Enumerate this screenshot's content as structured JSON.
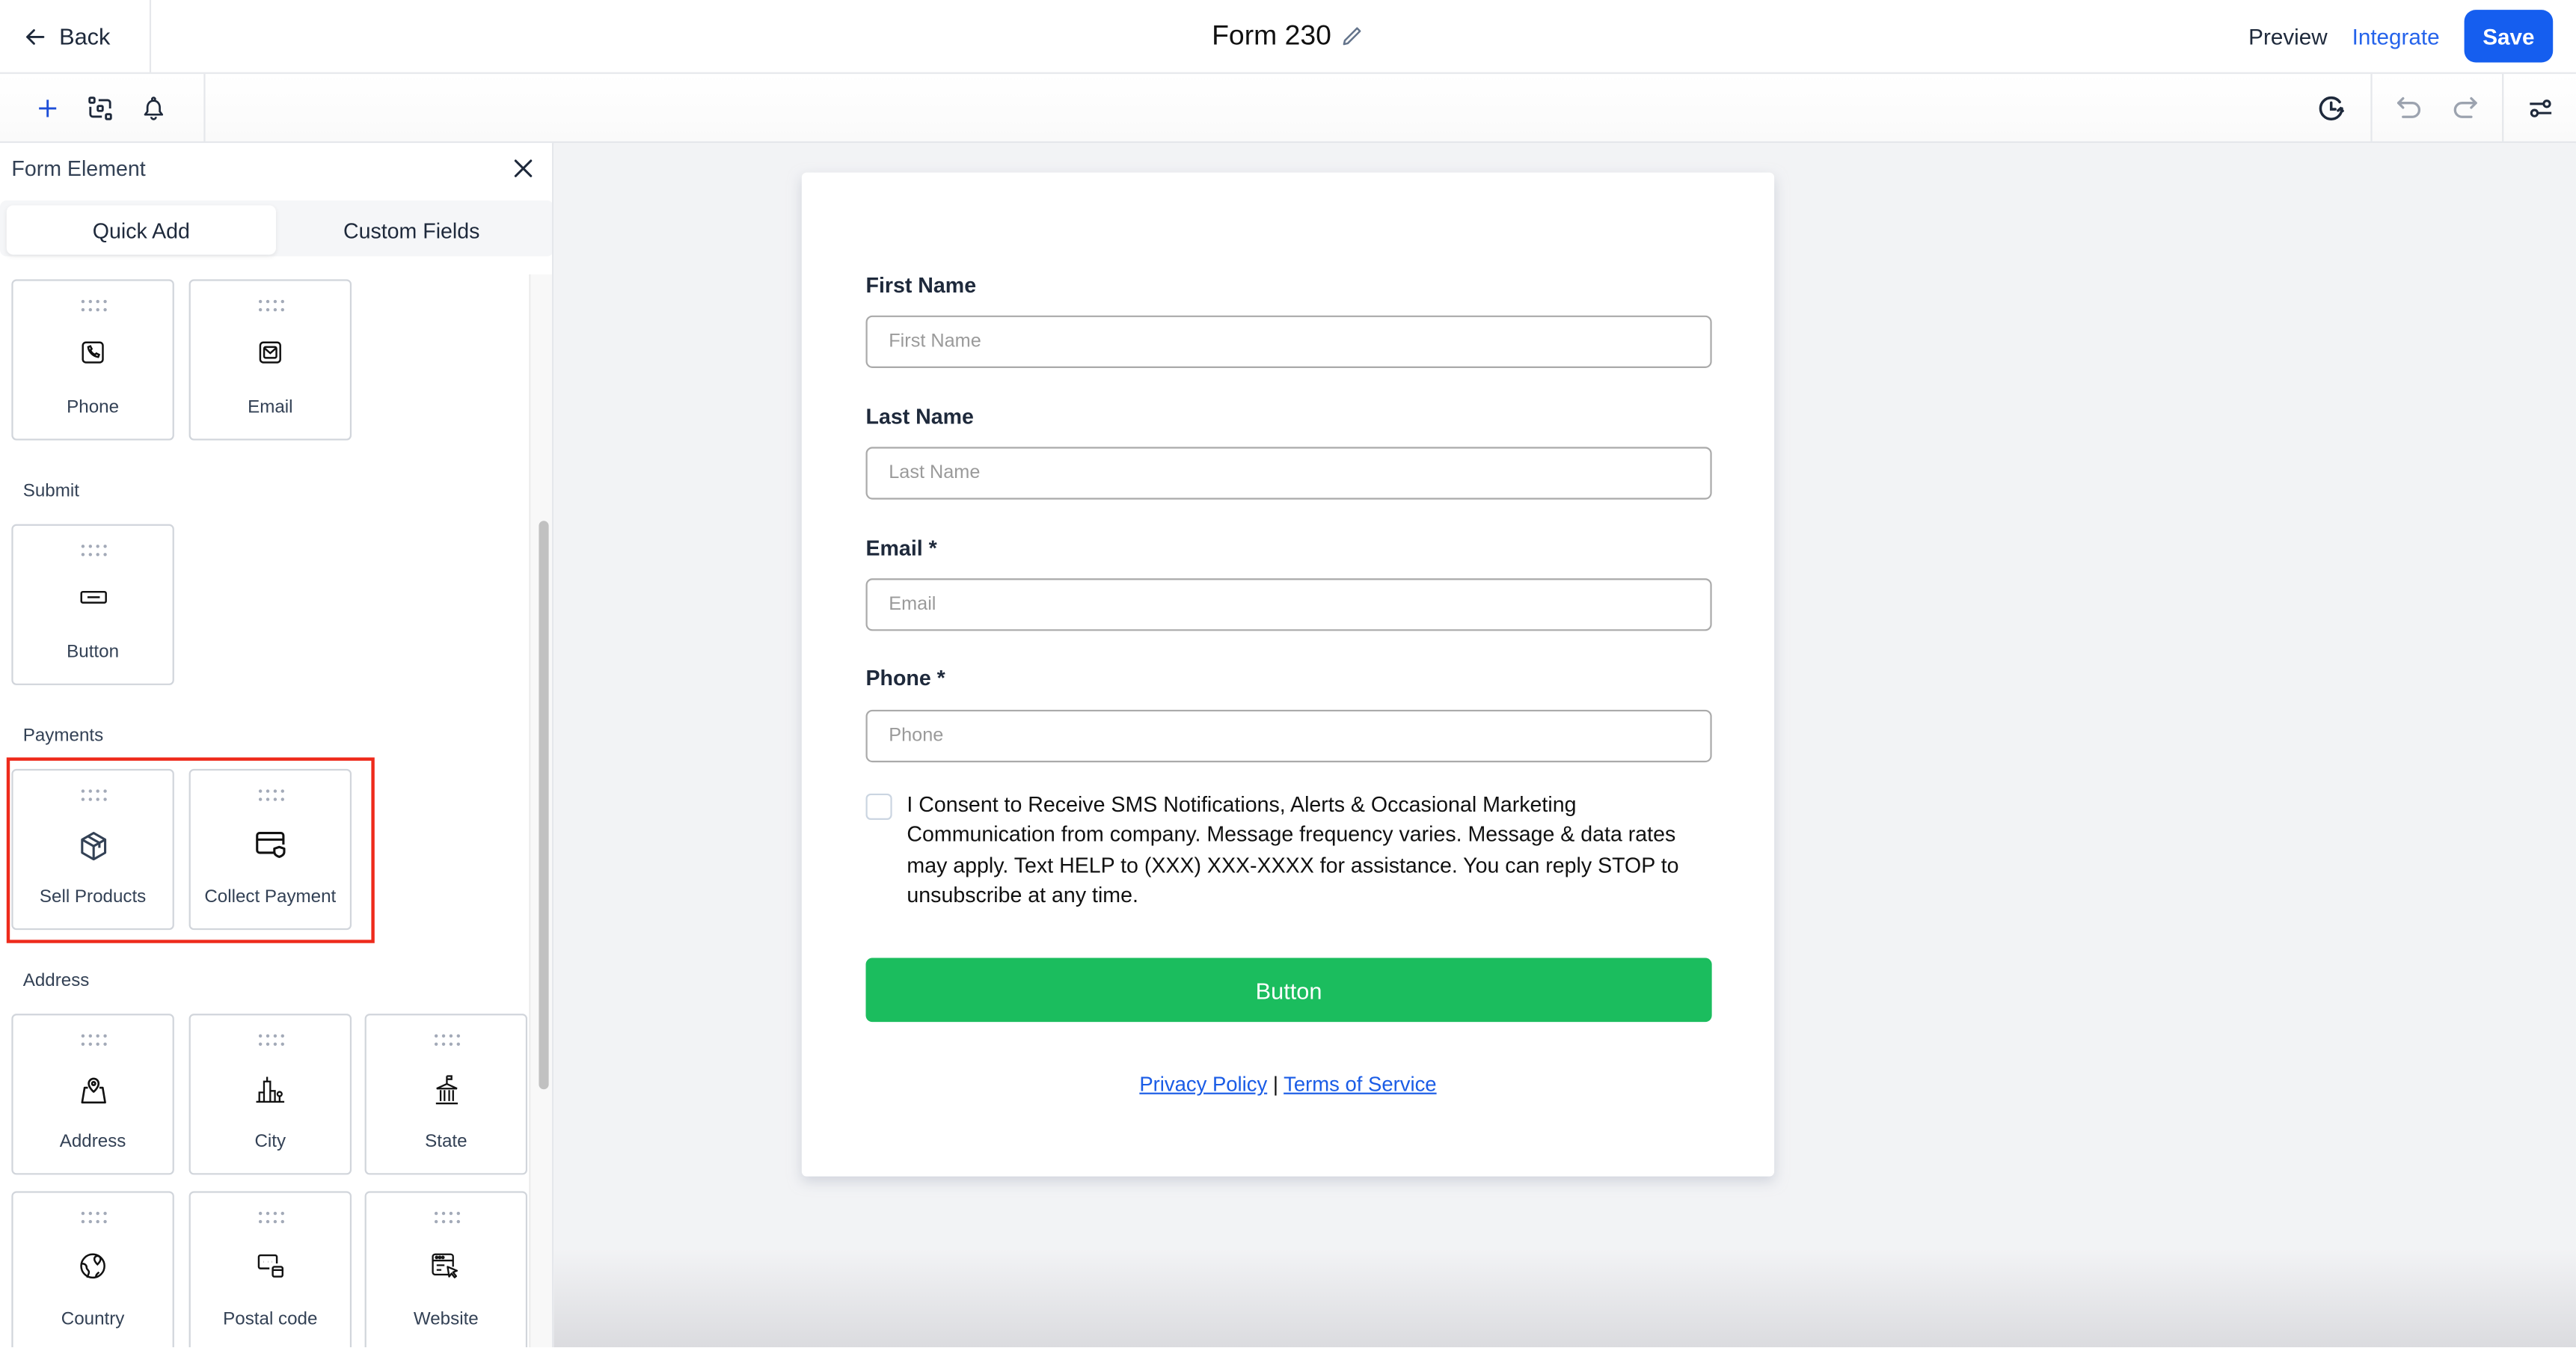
{
  "header": {
    "back_label": "Back",
    "title": "Form 230",
    "preview_label": "Preview",
    "integrate_label": "Integrate",
    "save_label": "Save",
    "colors": {
      "accent": "#155eef",
      "link": "#2563eb"
    }
  },
  "toolbar": {
    "left_icons": [
      "plus-icon",
      "layout-icon",
      "bell-icon"
    ],
    "right_icons": [
      "history-icon",
      "undo-icon",
      "redo-icon",
      "settings-sliders-icon"
    ]
  },
  "panel": {
    "title": "Form Element",
    "tabs": [
      {
        "label": "Quick Add",
        "active": true
      },
      {
        "label": "Custom Fields",
        "active": false
      }
    ],
    "sections": [
      {
        "label": "",
        "items": [
          {
            "label": "Phone",
            "icon": "phone-icon"
          },
          {
            "label": "Email",
            "icon": "email-icon"
          }
        ]
      },
      {
        "label": "Submit",
        "items": [
          {
            "label": "Button",
            "icon": "button-icon"
          }
        ]
      },
      {
        "label": "Payments",
        "highlighted": true,
        "items": [
          {
            "label": "Sell Products",
            "icon": "box-icon"
          },
          {
            "label": "Collect Payment",
            "icon": "card-shield-icon"
          }
        ]
      },
      {
        "label": "Address",
        "items": [
          {
            "label": "Address",
            "icon": "map-pin-icon"
          },
          {
            "label": "City",
            "icon": "city-icon"
          },
          {
            "label": "State",
            "icon": "capitol-icon"
          },
          {
            "label": "Country",
            "icon": "globe-icon"
          },
          {
            "label": "Postal code",
            "icon": "postal-code-icon"
          },
          {
            "label": "Website",
            "icon": "website-icon"
          }
        ]
      }
    ]
  },
  "form": {
    "fields": [
      {
        "label": "First Name",
        "placeholder": "First Name",
        "value": ""
      },
      {
        "label": "Last Name",
        "placeholder": "Last Name",
        "value": ""
      },
      {
        "label": "Email *",
        "placeholder": "Email",
        "value": ""
      },
      {
        "label": "Phone *",
        "placeholder": "Phone",
        "value": ""
      }
    ],
    "consent_checked": false,
    "consent_text": "I Consent to Receive SMS Notifications, Alerts & Occasional Marketing Communication from company. Message frequency varies. Message & data rates may apply. Text HELP to (XXX) XXX-XXXX for assistance. You can reply STOP to unsubscribe at any time.",
    "submit_label": "Button",
    "submit_color": "#1bbd5e",
    "privacy_label": "Privacy Policy",
    "separator": "|",
    "terms_label": "Terms of Service"
  }
}
